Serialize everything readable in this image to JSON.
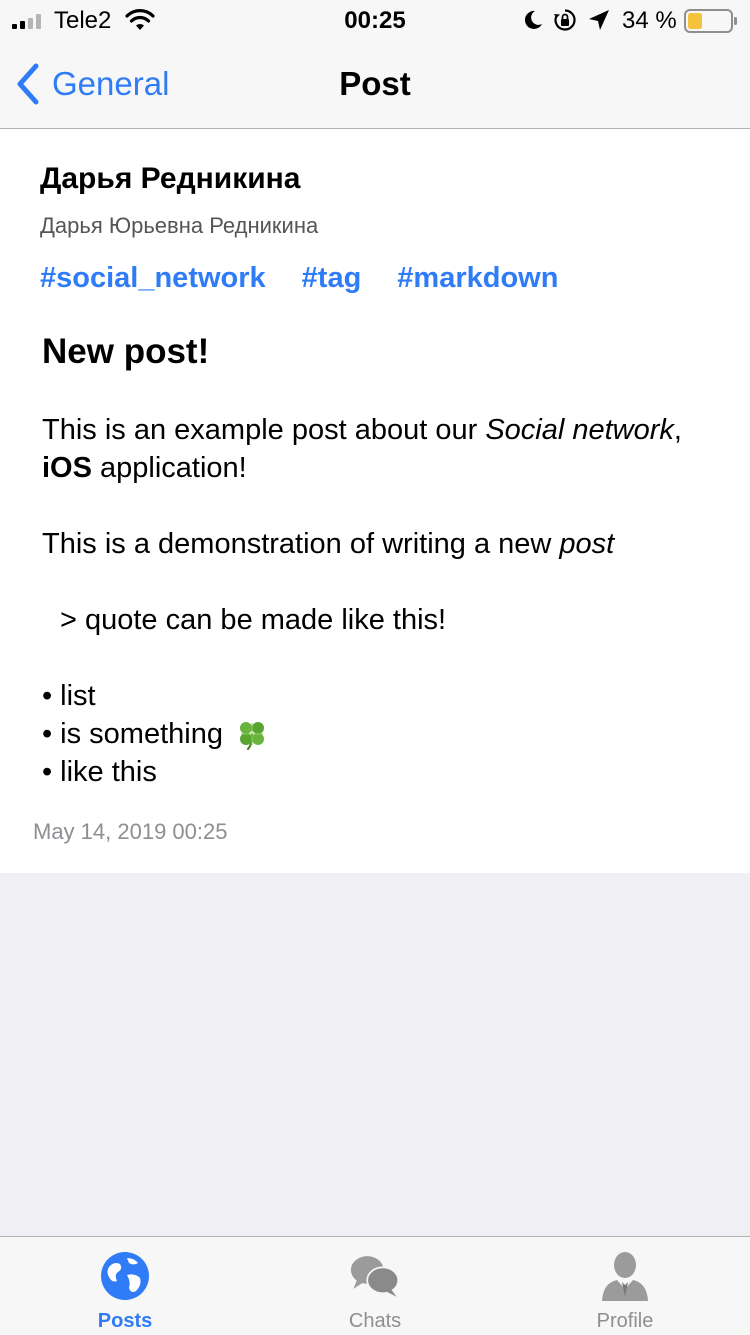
{
  "status_bar": {
    "carrier": "Tele2",
    "time": "00:25",
    "battery_percent": "34 %",
    "battery_level": 0.34,
    "battery_color": "#f5c33b"
  },
  "nav": {
    "back_label": "General",
    "title": "Post",
    "accent_color": "#2f7cf6"
  },
  "post": {
    "author_name": "Дарья Редникина",
    "author_full_name": "Дарья Юрьевна Редникина",
    "tags": [
      "#social_network",
      "#tag",
      "#markdown"
    ],
    "heading": "New post!",
    "body": {
      "p1_text1": "This is an example post about our ",
      "p1_italic1": "Social network",
      "p1_text2": ", ",
      "p1_bold": "iOS",
      "p1_text3": " application!",
      "p2_text": "This is a demonstration of writing a new ",
      "p2_italic": "post",
      "quote": "> quote can be made like this!",
      "list": [
        "list",
        "is something",
        "like this"
      ],
      "list_emoji_icon": "four-leaf-clover-icon"
    },
    "date": "May 14, 2019 00:25"
  },
  "tab_bar": {
    "tabs": [
      {
        "label": "Posts",
        "icon": "globe-icon",
        "active": true
      },
      {
        "label": "Chats",
        "icon": "chat-bubbles-icon",
        "active": false
      },
      {
        "label": "Profile",
        "icon": "person-icon",
        "active": false
      }
    ]
  }
}
